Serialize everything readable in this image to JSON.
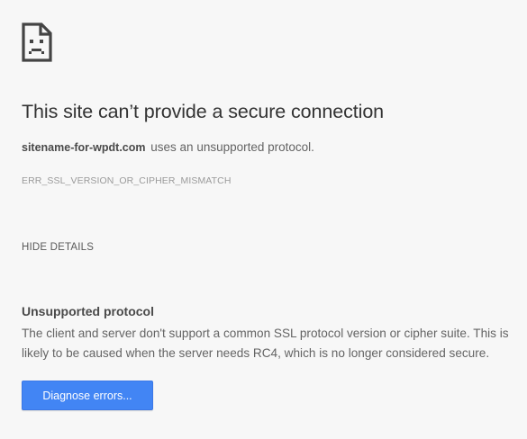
{
  "icon": "sad-document-icon",
  "title": "This site can’t provide a secure connection",
  "description": {
    "host": "sitename-for-wpdt.com",
    "text": "uses an unsupported protocol."
  },
  "error_code": "ERR_SSL_VERSION_OR_CIPHER_MISMATCH",
  "details_toggle_label": "HIDE DETAILS",
  "details": {
    "heading": "Unsupported protocol",
    "body": "The client and server don't support a common SSL protocol version or cipher suite. This is likely to be caused when the server needs RC4, which is no longer considered secure."
  },
  "button_label": "Diagnose errors...",
  "colors": {
    "background": "#f7f7f7",
    "button": "#4285f4",
    "title_text": "#333333",
    "body_text": "#646464"
  }
}
